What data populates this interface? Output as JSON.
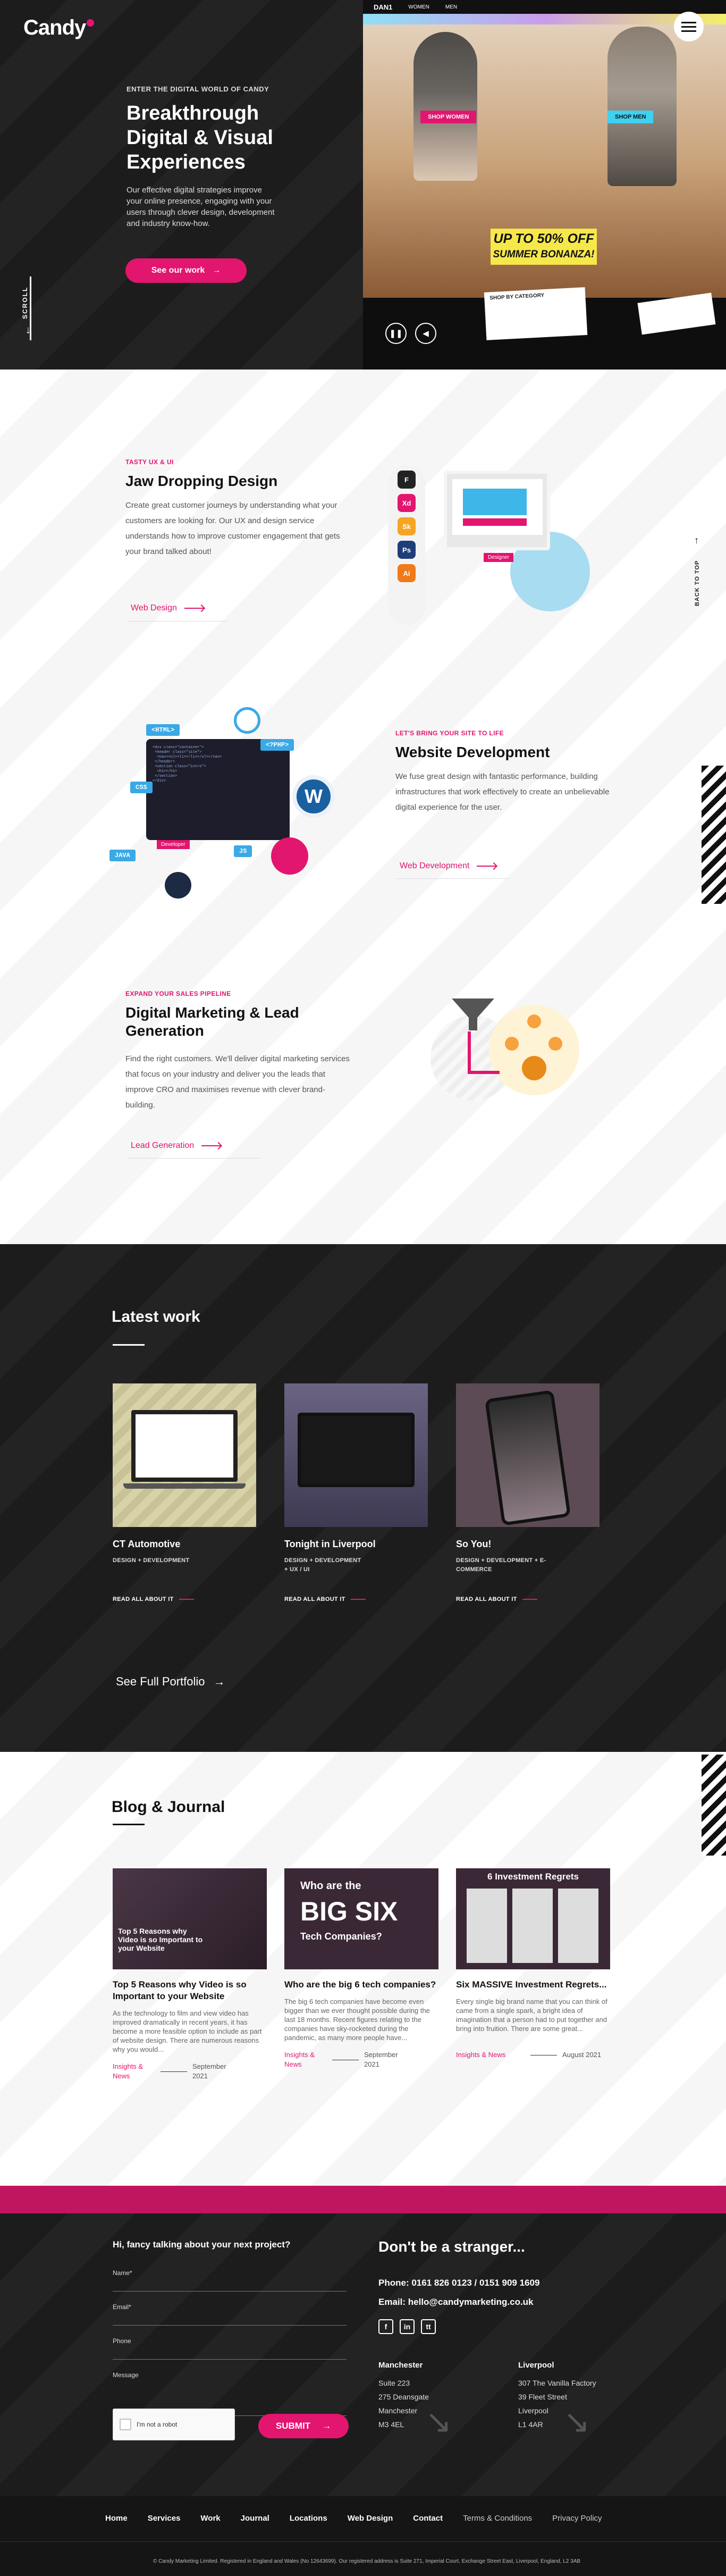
{
  "brand": {
    "logo": "Candy",
    "accent": "#e2156f"
  },
  "hero": {
    "kicker": "ENTER THE DIGITAL WORLD OF CANDY",
    "title": "Breakthrough Digital & Visual Experiences",
    "description": "Our effective digital strategies improve your online presence, engaging with your users through clever design, development and industry know-how.",
    "cta": "See our work",
    "scroll_label": "SCROLL",
    "showcase": {
      "nav": [
        "DAN1",
        "WOMEN",
        "MEN"
      ],
      "shop_women": "SHOP WOMEN",
      "shop_men": "SHOP MEN",
      "promo_line1": "UP TO 50% OFF",
      "promo_line2": "SUMMER BONANZA!",
      "category": "SHOP BY CATEGORY"
    }
  },
  "back_to_top": "BACK TO TOP",
  "services": [
    {
      "kicker": "TASTY UX & UI",
      "title": "Jaw Dropping Design",
      "description": "Create great customer journeys by understanding what your customers are looking for. Our UX and design service understands how to improve customer engagement that gets your brand talked about!",
      "link": "Web Design"
    },
    {
      "kicker": "LET'S BRING YOUR SITE TO LIFE",
      "title": "Website Development",
      "description": "We fuse great design with fantastic performance, building infrastructures that work effectively to create an unbelievable digital experience for the user.",
      "link": "Web Development"
    },
    {
      "kicker": "EXPAND YOUR SALES PIPELINE",
      "title": "Digital Marketing & Lead Generation",
      "description": "Find the right customers. We'll deliver digital marketing services that focus on your industry and deliver you the leads that improve CRO and maximises revenue with clever brand-building.",
      "link": "Lead Generation"
    }
  ],
  "illustration_labels": {
    "design": "Designer",
    "html": "<HTML>",
    "php": "<?PHP>",
    "css": "CSS",
    "java": "JAVA",
    "js": "JS",
    "developer": "Developer",
    "tools": [
      "F",
      "Xd",
      "Sk",
      "Ps",
      "Ai"
    ]
  },
  "work": {
    "title": "Latest work",
    "items": [
      {
        "name": "CT Automotive",
        "tags": "DESIGN + DEVELOPMENT",
        "link": "READ ALL ABOUT IT"
      },
      {
        "name": "Tonight in Liverpool",
        "tags": "DESIGN + DEVELOPMENT + UX / UI",
        "link": "READ ALL ABOUT IT"
      },
      {
        "name": "So You!",
        "tags": "DESIGN + DEVELOPMENT + E-COMMERCE",
        "link": "READ ALL ABOUT IT"
      }
    ],
    "portfolio_link": "See Full Portfolio"
  },
  "blog": {
    "title": "Blog & Journal",
    "posts": [
      {
        "image_text": "Top 5 Reasons why Video is so Important to your Website",
        "title": "Top 5 Reasons why Video is so Important to your Website",
        "excerpt": "As the technology to film and view video has improved dramatically in recent years, it has become a more feasible option to include as part of website design. There are numerous reasons why you would...",
        "category": "Insights & News",
        "date": "September 2021"
      },
      {
        "image_text_top": "Who are the",
        "image_text_big": "BIG SIX",
        "image_text_bottom": "Tech Companies?",
        "title": "Who are the big 6 tech companies?",
        "excerpt": "The big 6 tech companies have become even bigger than we ever thought possible during the last 18 months. Recent figures relating to the companies have sky-rocketed during the pandemic, as many more people have...",
        "category": "Insights & News",
        "date": "September 2021"
      },
      {
        "image_text": "6 Investment Regrets",
        "title": "Six MASSIVE Investment Regrets...",
        "excerpt": "Every single big brand name that you can think of came from a single spark, a bright idea of imagination that a person had to put together and bring into fruition. There are some great...",
        "category": "Insights & News",
        "date": "August 2021"
      }
    ]
  },
  "contact": {
    "form_title": "Hi, fancy talking about your next project?",
    "fields": [
      "Name*",
      "Email*",
      "Phone",
      "Message"
    ],
    "recaptcha": "I'm not a robot",
    "submit": "SUBMIT",
    "heading": "Don't be a stranger...",
    "phone_label": "Phone:",
    "phone": "0161 826 0123 / 0151 909 1609",
    "email_label": "Email:",
    "email": "hello@candymarketing.co.uk",
    "socials": [
      "f",
      "in",
      "tt"
    ],
    "offices": [
      {
        "city": "Manchester",
        "lines": [
          "Suite 223",
          "275 Deansgate",
          "Manchester",
          "M3 4EL"
        ]
      },
      {
        "city": "Liverpool",
        "lines": [
          "307 The Vanilla Factory",
          "39 Fleet Street",
          "Liverpool",
          "L1 4AR"
        ]
      }
    ]
  },
  "footer": {
    "nav": [
      "Home",
      "Services",
      "Work",
      "Journal",
      "Locations",
      "Web Design",
      "Contact"
    ],
    "secondary": [
      "Terms & Conditions",
      "Privacy Policy"
    ],
    "copyright": "© Candy Marketing Limited. Registered in England and Wales (No 12643699). Our registered address is Suite 271, Imperial Court, Exchange Street East, Liverpool, England, L2 3AB"
  }
}
